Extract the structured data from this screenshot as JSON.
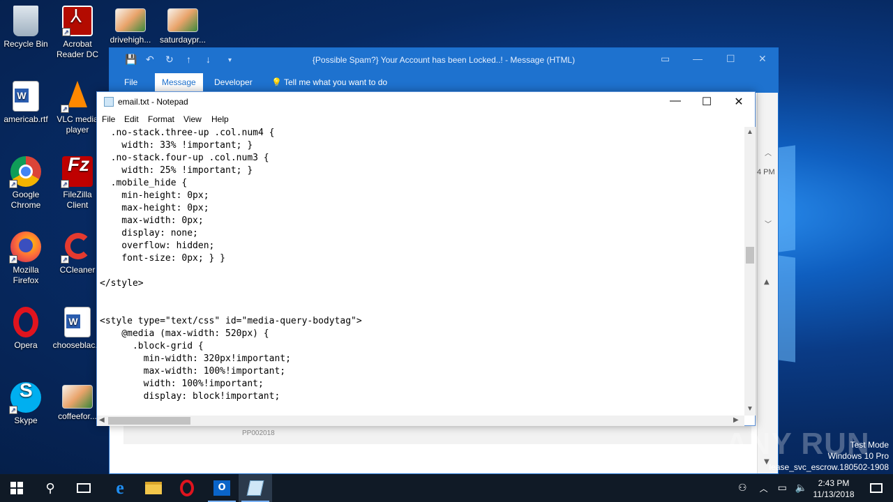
{
  "desktop": {
    "icons": [
      {
        "label": "Recycle Bin",
        "icon": "recycle-bin-icon"
      },
      {
        "label": "Acrobat Reader DC",
        "icon": "acrobat-icon"
      },
      {
        "label": "drivehigh...",
        "icon": "image-file-icon"
      },
      {
        "label": "saturdaypr...",
        "icon": "image-file-icon"
      },
      {
        "label": "americab.rtf",
        "icon": "word-doc-icon"
      },
      {
        "label": "VLC media player",
        "icon": "vlc-icon"
      },
      {
        "label": "Google Chrome",
        "icon": "chrome-icon"
      },
      {
        "label": "FileZilla Client",
        "icon": "filezilla-icon"
      },
      {
        "label": "Mozilla Firefox",
        "icon": "firefox-icon"
      },
      {
        "label": "CCleaner",
        "icon": "ccleaner-icon"
      },
      {
        "label": "Opera",
        "icon": "opera-icon"
      },
      {
        "label": "chooseblac...",
        "icon": "word-doc-icon"
      },
      {
        "label": "Skype",
        "icon": "skype-icon"
      },
      {
        "label": "coffeefor...",
        "icon": "image-file-icon"
      }
    ]
  },
  "outlook": {
    "title": "{Possible Spam?} Your Account has been Locked..! - Message (HTML)",
    "tabs": [
      "File",
      "Message",
      "Developer"
    ],
    "active_tab": "Message",
    "tell_me": "Tell me what you want to do",
    "time_fragment": "4 PM",
    "footer_text": "PP002018"
  },
  "notepad": {
    "title": "email.txt - Notepad",
    "menu": [
      "File",
      "Edit",
      "Format",
      "View",
      "Help"
    ],
    "lines": [
      "  .no-stack.three-up .col.num4 {",
      "    width: 33% !important; }",
      "  .no-stack.four-up .col.num3 {",
      "    width: 25% !important; }",
      "  .mobile_hide {",
      "    min-height: 0px;",
      "    max-height: 0px;",
      "    max-width: 0px;",
      "    display: none;",
      "    overflow: hidden;",
      "    font-size: 0px; } }",
      "",
      "</style>",
      "",
      "",
      "<style type=\"text/css\" id=\"media-query-bodytag\">",
      "    @media (max-width: 520px) {",
      "      .block-grid {",
      "        min-width: 320px!important;",
      "        max-width: 100%!important;",
      "        width: 100%!important;",
      "        display: block!important;"
    ]
  },
  "watermark": "ANY RUN",
  "system": {
    "test_mode": "Test Mode",
    "edition": "Windows 10 Pro",
    "build": "lease_svc_escrow.180502-1908",
    "time": "2:43 PM",
    "date": "11/13/2018"
  },
  "taskbar": {
    "apps": [
      "start-icon",
      "search-icon",
      "task-view-icon",
      "edge-icon",
      "file-explorer-icon",
      "opera-icon",
      "outlook-icon",
      "notepad-icon"
    ]
  },
  "colors": {
    "outlook_blue": "#1e72cf",
    "taskbar": "#101a26"
  }
}
